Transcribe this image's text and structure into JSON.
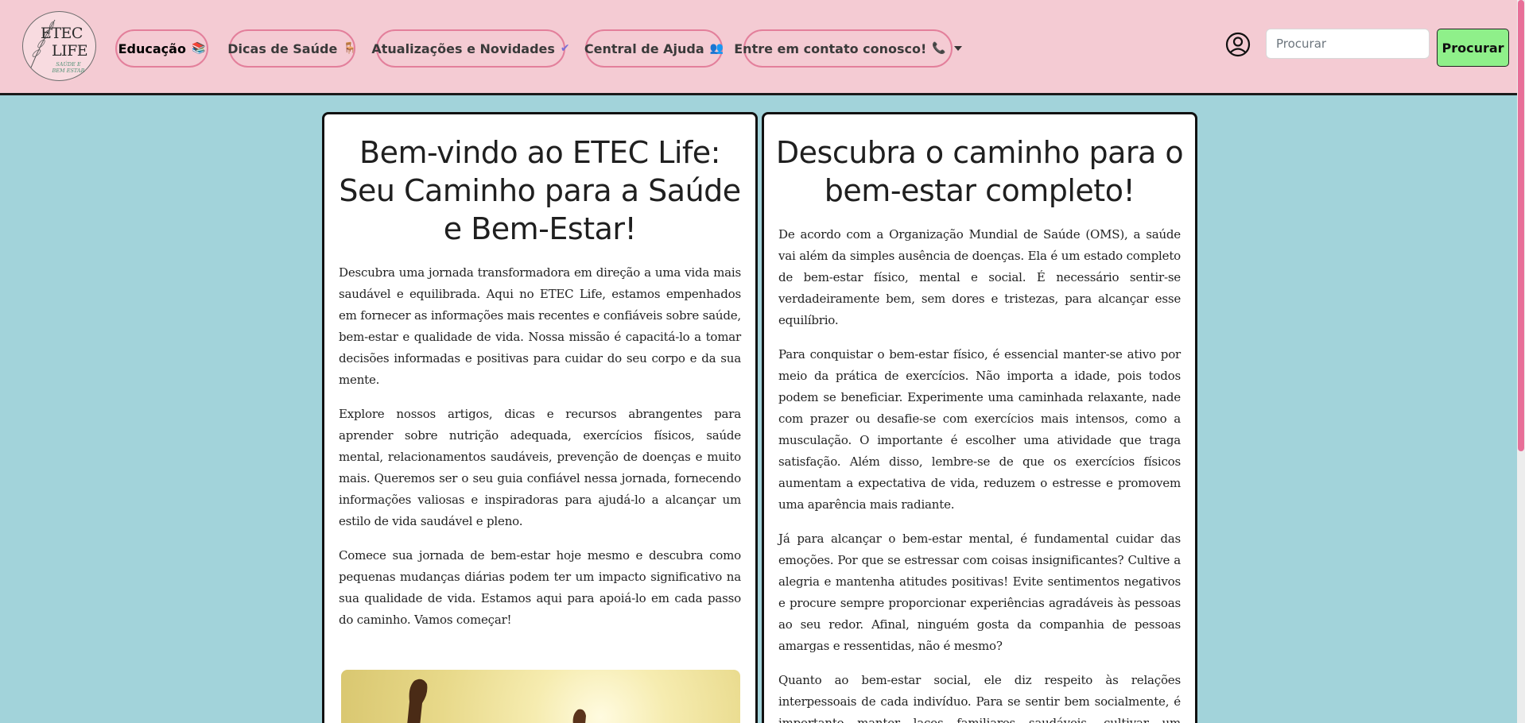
{
  "logo": {
    "line1": "ETEC",
    "line2": "LIFE",
    "tagline1": "SAÚDE E",
    "tagline2": "BEM ESTAR"
  },
  "nav": {
    "items": [
      {
        "label": "Educação",
        "emoji": "📚"
      },
      {
        "label": "Dicas de Saúde",
        "emoji": "🪑"
      },
      {
        "label": "Atualizações e Novidades",
        "emoji": "✔"
      },
      {
        "label": "Central de Ajuda",
        "emoji": "👥"
      },
      {
        "label": "Entre em contato conosco!",
        "emoji": "📞"
      }
    ]
  },
  "search": {
    "placeholder": "Procurar",
    "button_label": "Procurar"
  },
  "left_card": {
    "title": "Bem-vindo ao ETEC Life: Seu Caminho para a Saúde e Bem-Estar!",
    "paragraphs": [
      "Descubra uma jornada transformadora em direção a uma vida mais saudável e equilibrada. Aqui no ETEC Life, estamos empenhados em fornecer as informações mais recentes e confiáveis sobre saúde, bem-estar e qualidade de vida. Nossa missão é capacitá-lo a tomar decisões informadas e positivas para cuidar do seu corpo e da sua mente.",
      "Explore nossos artigos, dicas e recursos abrangentes para aprender sobre nutrição adequada, exercícios físicos, saúde mental, relacionamentos saudáveis, prevenção de doenças e muito mais. Queremos ser o seu guia confiável nessa jornada, fornecendo informações valiosas e inspiradoras para ajudá-lo a alcançar um estilo de vida saudável e pleno.",
      "Comece sua jornada de bem-estar hoje mesmo e descubra como pequenas mudanças diárias podem ter um impacto significativo na sua qualidade de vida. Estamos aqui para apoiá-lo em cada passo do caminho. Vamos começar!"
    ]
  },
  "right_card": {
    "title": "Descubra o caminho para o bem-estar completo!",
    "paragraphs": [
      "De acordo com a Organização Mundial de Saúde (OMS), a saúde vai além da simples ausência de doenças. Ela é um estado completo de bem-estar físico, mental e social. É necessário sentir-se verdadeiramente bem, sem dores e tristezas, para alcançar esse equilíbrio.",
      "Para conquistar o bem-estar físico, é essencial manter-se ativo por meio da prática de exercícios. Não importa a idade, pois todos podem se beneficiar. Experimente uma caminhada relaxante, nade com prazer ou desafie-se com exercícios mais intensos, como a musculação. O importante é escolher uma atividade que traga satisfação. Além disso, lembre-se de que os exercícios físicos aumentam a expectativa de vida, reduzem o estresse e promovem uma aparência mais radiante.",
      "Já para alcançar o bem-estar mental, é fundamental cuidar das emoções. Por que se estressar com coisas insignificantes? Cultive a alegria e mantenha atitudes positivas! Evite sentimentos negativos e procure sempre proporcionar experiências agradáveis às pessoas ao seu redor. Afinal, ninguém gosta da companhia de pessoas amargas e ressentidas, não é mesmo?",
      "Quanto ao bem-estar social, ele diz respeito às relações interpessoais de cada indivíduo. Para se sentir bem socialmente, é importante manter laços familiares saudáveis, cultivar um ambiente de trabalho"
    ]
  },
  "colors": {
    "navbar_bg": "#f4cbd3",
    "page_bg": "#a2d3da",
    "pill_border": "#e37f9b",
    "search_button_bg": "#8ff08a",
    "scroll_thumb": "#e86f98"
  }
}
